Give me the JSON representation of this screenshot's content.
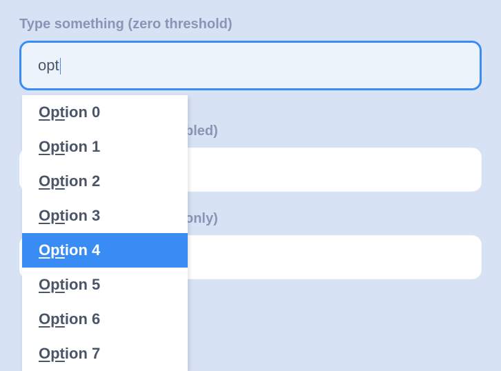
{
  "field1": {
    "label": "Type something (zero threshold)",
    "value": "opt",
    "matchPrefix": "Opt",
    "dropdown": {
      "items": [
        {
          "rest": "ion 0",
          "highlighted": false
        },
        {
          "rest": "ion 1",
          "highlighted": false
        },
        {
          "rest": "ion 2",
          "highlighted": false
        },
        {
          "rest": "ion 3",
          "highlighted": false
        },
        {
          "rest": "ion 4",
          "highlighted": true
        },
        {
          "rest": "ion 5",
          "highlighted": false
        },
        {
          "rest": "ion 6",
          "highlighted": false
        },
        {
          "rest": "ion 7",
          "highlighted": false
        }
      ]
    }
  },
  "field2": {
    "labelVisible": "bled)"
  },
  "field3": {
    "labelVisible": "only)"
  }
}
